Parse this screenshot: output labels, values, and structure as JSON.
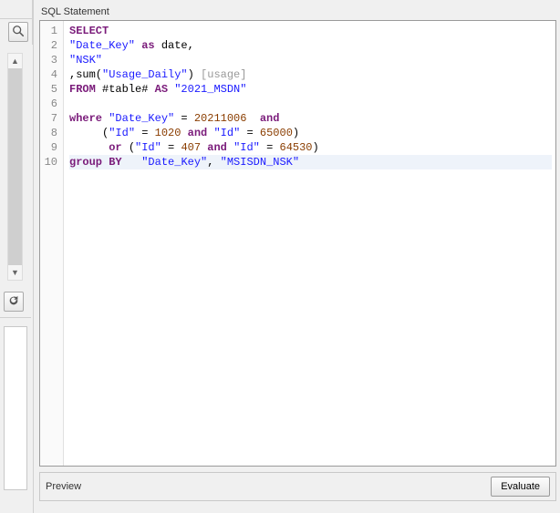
{
  "panel": {
    "title": "SQL Statement"
  },
  "preview": {
    "label": "Preview",
    "evaluate_label": "Evaluate"
  },
  "icons": {
    "search": "search-icon",
    "refresh": "refresh-icon"
  },
  "editor": {
    "highlighted_line": 10,
    "lines": [
      {
        "n": 1,
        "tokens": [
          {
            "t": "SELECT",
            "c": "kw"
          }
        ]
      },
      {
        "n": 2,
        "tokens": [
          {
            "t": "\"Date_Key\"",
            "c": "str"
          },
          {
            "t": " "
          },
          {
            "t": "as",
            "c": "kw"
          },
          {
            "t": " date,"
          }
        ]
      },
      {
        "n": 3,
        "tokens": [
          {
            "t": "\"NSK\"",
            "c": "str"
          }
        ]
      },
      {
        "n": 4,
        "tokens": [
          {
            "t": ",sum("
          },
          {
            "t": "\"Usage_Daily\"",
            "c": "str"
          },
          {
            "t": ") "
          },
          {
            "t": "[usage]",
            "c": "com"
          }
        ]
      },
      {
        "n": 5,
        "tokens": [
          {
            "t": "FROM",
            "c": "kw"
          },
          {
            "t": " #table# "
          },
          {
            "t": "AS",
            "c": "kw"
          },
          {
            "t": " "
          },
          {
            "t": "\"2021_MSDN\"",
            "c": "str"
          }
        ]
      },
      {
        "n": 6,
        "tokens": [
          {
            "t": ""
          }
        ]
      },
      {
        "n": 7,
        "tokens": [
          {
            "t": "where",
            "c": "kw"
          },
          {
            "t": " "
          },
          {
            "t": "\"Date_Key\"",
            "c": "str"
          },
          {
            "t": " = "
          },
          {
            "t": "20211006",
            "c": "num"
          },
          {
            "t": "  "
          },
          {
            "t": "and",
            "c": "kw"
          }
        ]
      },
      {
        "n": 8,
        "tokens": [
          {
            "t": "     ("
          },
          {
            "t": "\"Id\"",
            "c": "str"
          },
          {
            "t": " = "
          },
          {
            "t": "1020",
            "c": "num"
          },
          {
            "t": " "
          },
          {
            "t": "and",
            "c": "kw"
          },
          {
            "t": " "
          },
          {
            "t": "\"Id\"",
            "c": "str"
          },
          {
            "t": " = "
          },
          {
            "t": "65000",
            "c": "num"
          },
          {
            "t": ")"
          }
        ]
      },
      {
        "n": 9,
        "tokens": [
          {
            "t": "      "
          },
          {
            "t": "or",
            "c": "kw"
          },
          {
            "t": " ("
          },
          {
            "t": "\"Id\"",
            "c": "str"
          },
          {
            "t": " = "
          },
          {
            "t": "407",
            "c": "num"
          },
          {
            "t": " "
          },
          {
            "t": "and",
            "c": "kw"
          },
          {
            "t": " "
          },
          {
            "t": "\"Id\"",
            "c": "str"
          },
          {
            "t": " = "
          },
          {
            "t": "64530",
            "c": "num"
          },
          {
            "t": ")"
          }
        ]
      },
      {
        "n": 10,
        "tokens": [
          {
            "t": "group",
            "c": "kw"
          },
          {
            "t": " "
          },
          {
            "t": "BY",
            "c": "kw"
          },
          {
            "t": "   "
          },
          {
            "t": "\"Date_Key\"",
            "c": "str"
          },
          {
            "t": ", "
          },
          {
            "t": "\"MSISDN_NSK\"",
            "c": "str"
          }
        ]
      }
    ]
  }
}
